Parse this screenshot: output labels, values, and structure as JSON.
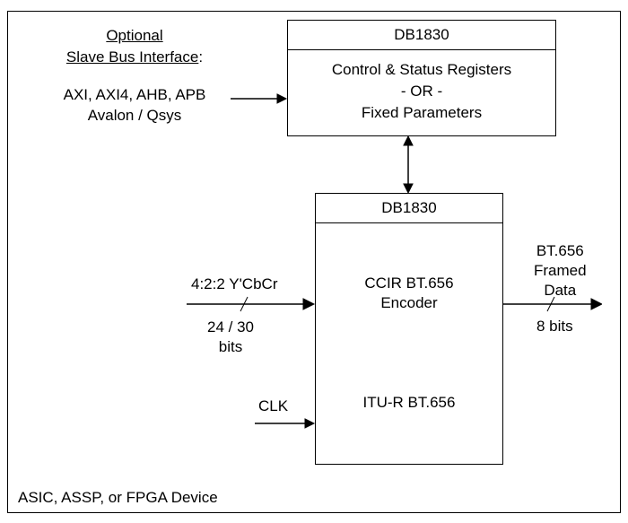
{
  "optional": {
    "title_line1": "Optional",
    "title_line2": "Slave Bus Interface",
    "list_line1": "AXI, AXI4, AHB, APB",
    "list_line2": "Avalon / Qsys"
  },
  "upper_block": {
    "header": "DB1830",
    "body_line1": "Control & Status Registers",
    "body_line2": "- OR -",
    "body_line3": "Fixed Parameters"
  },
  "lower_block": {
    "header": "DB1830",
    "ccir_line1": "CCIR BT.656",
    "ccir_line2": "Encoder",
    "itu": "ITU-R BT.656"
  },
  "input": {
    "top": "4:2:2 Y'CbCr",
    "bottom_line1": "24 / 30",
    "bottom_line2": "bits"
  },
  "output": {
    "top_line1": "BT.656",
    "top_line2": "Framed",
    "top_line3": "Data",
    "bottom": "8 bits"
  },
  "clk": "CLK",
  "footer": "ASIC, ASSP, or FPGA  Device"
}
